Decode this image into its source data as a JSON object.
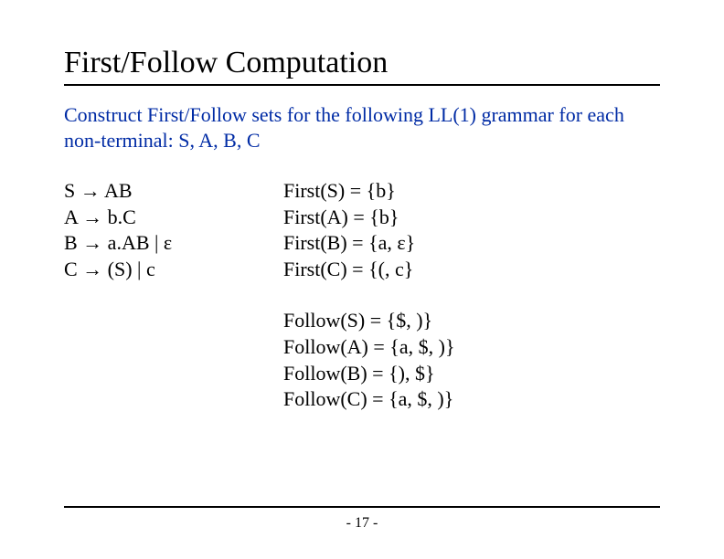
{
  "title": "First/Follow Computation",
  "subtitle": "Construct First/Follow sets for the following LL(1) grammar for each non-terminal: S, A, B, C",
  "grammar": {
    "p1": "S → AB",
    "p2": "A → b.C",
    "p3": "B → a.AB | ε",
    "p4": "C → (S) | c"
  },
  "first": {
    "f1": "First(S) = {b}",
    "f2": "First(A) = {b}",
    "f3": "First(B) = {a, ε}",
    "f4": "First(C) = {(, c}"
  },
  "follow": {
    "w1": "Follow(S) = {$, )}",
    "w2": "Follow(A) = {a, $, )}",
    "w3": "Follow(B) = {), $}",
    "w4": "Follow(C) = {a, $, )}"
  },
  "page": "- 17 -"
}
